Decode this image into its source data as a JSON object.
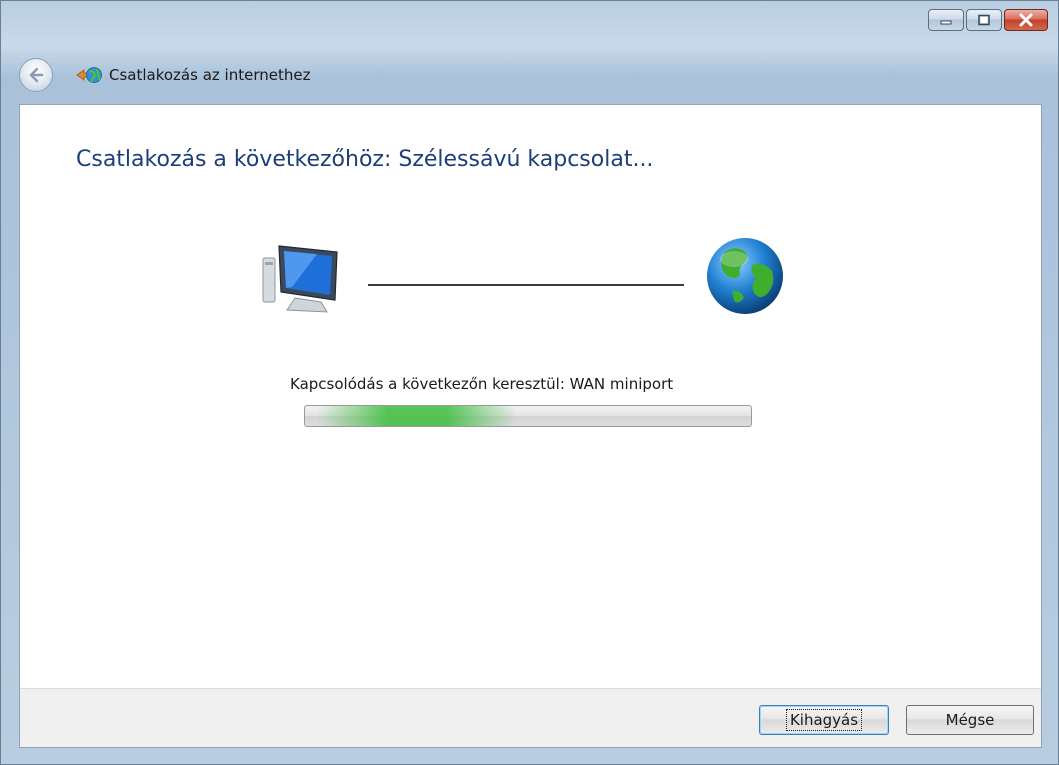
{
  "window": {
    "controls": {
      "minimize_icon": "minimize-icon",
      "maximize_icon": "maximize-icon",
      "close_icon": "close-icon"
    }
  },
  "nav": {
    "back_icon": "back-arrow-icon",
    "wizard_icon": "network-globe-icon",
    "title": "Csatlakozás az internethez"
  },
  "main": {
    "heading": "Csatlakozás a következőhöz: Szélessávú kapcsolat...",
    "computer_icon": "computer-icon",
    "globe_icon": "globe-icon",
    "status": "Kapcsolódás a következőn keresztül: WAN miniport",
    "progress": {
      "type": "marquee",
      "color": "#3cbe3c"
    }
  },
  "footer": {
    "skip_label": "Kihagyás",
    "cancel_label": "Mégse"
  },
  "colors": {
    "heading": "#1e3e7a",
    "frame": "#b8cde0",
    "close": "#c1412a"
  }
}
